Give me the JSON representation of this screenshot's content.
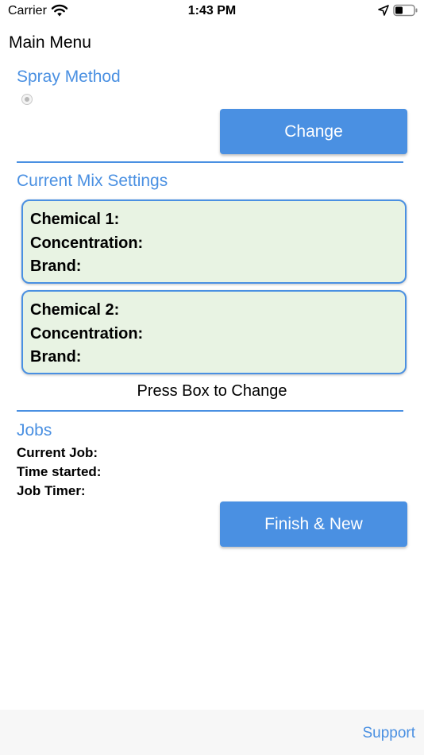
{
  "status_bar": {
    "carrier": "Carrier",
    "time": "1:43 PM",
    "icons": [
      "wifi-icon",
      "location-icon",
      "battery-icon"
    ]
  },
  "page_title": "Main Menu",
  "spray_method": {
    "title": "Spray Method",
    "change_label": "Change"
  },
  "mix": {
    "title": "Current Mix Settings",
    "chemicals": [
      {
        "chemical": "Chemical 1:",
        "concentration": "Concentration:",
        "brand": "Brand:"
      },
      {
        "chemical": "Chemical 2:",
        "concentration": "Concentration:",
        "brand": "Brand:"
      }
    ],
    "hint": "Press Box to Change"
  },
  "jobs": {
    "title": "Jobs",
    "current_job": "Current Job:",
    "time_started": "Time started:",
    "job_timer": "Job Timer:",
    "finish_label": "Finish & New"
  },
  "footer": {
    "support_label": "Support"
  },
  "colors": {
    "accent": "#4a90e2",
    "box_fill": "#e8f3e3",
    "footer_bg": "#f7f7f7"
  }
}
